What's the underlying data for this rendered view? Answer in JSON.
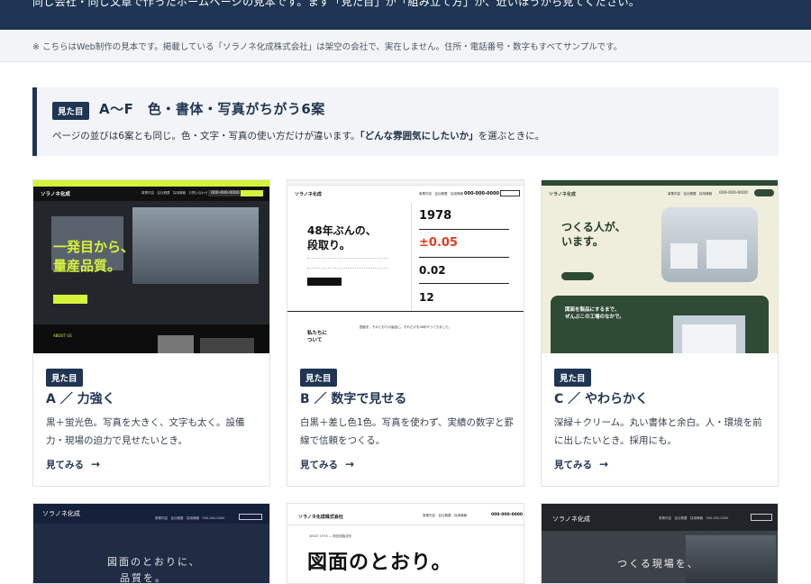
{
  "header": {
    "intro_text": "同じ会社・同じ文章で作ったホームページの見本です。まず「見た目」か「組み立て方」か、近いほうから見てください。"
  },
  "notice": {
    "text": "※ こちらはWeb制作の見本です。掲載している「ソラノネ化成株式会社」は架空の会社で、実在しません。住所・電話番号・数字もすべてサンプルです。"
  },
  "section": {
    "badge": "見た目",
    "title": "A〜F　色・書体・写真がちがう6案",
    "desc_before": "ページの並びは6案とも同じ。色・文字・写真の使い方だけが違います。",
    "desc_bold": "「どんな雰囲気にしたいか」",
    "desc_after": "を選ぶときに。"
  },
  "cards": [
    {
      "badge": "見た目",
      "title": "A ／ 力強く",
      "desc": "黒＋蛍光色。写真を大きく、文字も太く。設備力・現場の迫力で見せたいとき。",
      "link": "見てみる",
      "thumb": {
        "logo": "ソラノネ化成",
        "nav": "事業内容　会社概要　採用情報　お問い合わせ",
        "phone": "000-000-0000",
        "hero_line1": "一発目から、",
        "hero_line2": "量産品質。",
        "lower_heading": "ABOUT US"
      }
    },
    {
      "badge": "見た目",
      "title": "B ／ 数字で見せる",
      "desc": "白黒＋差し色1色。写真を使わず、実績の数字と罫線で信頼をつくる。",
      "link": "見てみる",
      "thumb": {
        "logo": "ソラノネ化成",
        "nav": "事業内容　会社概要　採用情報",
        "phone": "000-000-0000",
        "hero_line1": "48年ぶんの、",
        "hero_line2": "段取り。",
        "stat1": "1978",
        "stat2": "±0.05",
        "stat3": "0.02",
        "stat4": "12",
        "bottom_heading_1": "私たちに",
        "bottom_heading_2": "ついて",
        "bottom_text": "図面を、そのとおりの製品に。それだけを48年やってきました。"
      }
    },
    {
      "badge": "見た目",
      "title": "C ／ やわらかく",
      "desc": "深緑＋クリーム。丸い書体と余白。人・環境を前に出したいとき。採用にも。",
      "link": "見てみる",
      "thumb": {
        "logo": "ソラノネ化成",
        "nav": "事業内容　会社概要　採用情報",
        "phone": "000-000-0000",
        "hero_line1": "つくる人が、",
        "hero_line2": "います。",
        "green_line1": "図面を製品にするまで、",
        "green_line2": "ぜんぶこの工場のなかで。"
      }
    }
  ],
  "cards_row2": [
    {
      "thumb": {
        "logo": "ソラノネ化成",
        "nav": "事業内容　会社概要　採用情報　000-000-0000",
        "hero_line1": "図面のとおりに、",
        "hero_line2": "品質を。"
      }
    },
    {
      "thumb": {
        "logo": "ソラノネ化成株式会社",
        "nav": "事業内容　会社概要　採用情報",
        "phone": "000-000-0000",
        "small": "SINCE 1978 — 精密樹脂成形",
        "hero": "図面のとおり。"
      }
    },
    {
      "thumb": {
        "logo": "ソラノネ化成",
        "nav": "事業内容　会社概要　採用情報　000-000-0000",
        "hero": "つくる現場を、"
      }
    }
  ],
  "colors": {
    "navy": "#1f3553",
    "accent_yellow": "#d7f23a",
    "accent_red": "#e53b1c",
    "accent_green": "#2f4a35"
  }
}
